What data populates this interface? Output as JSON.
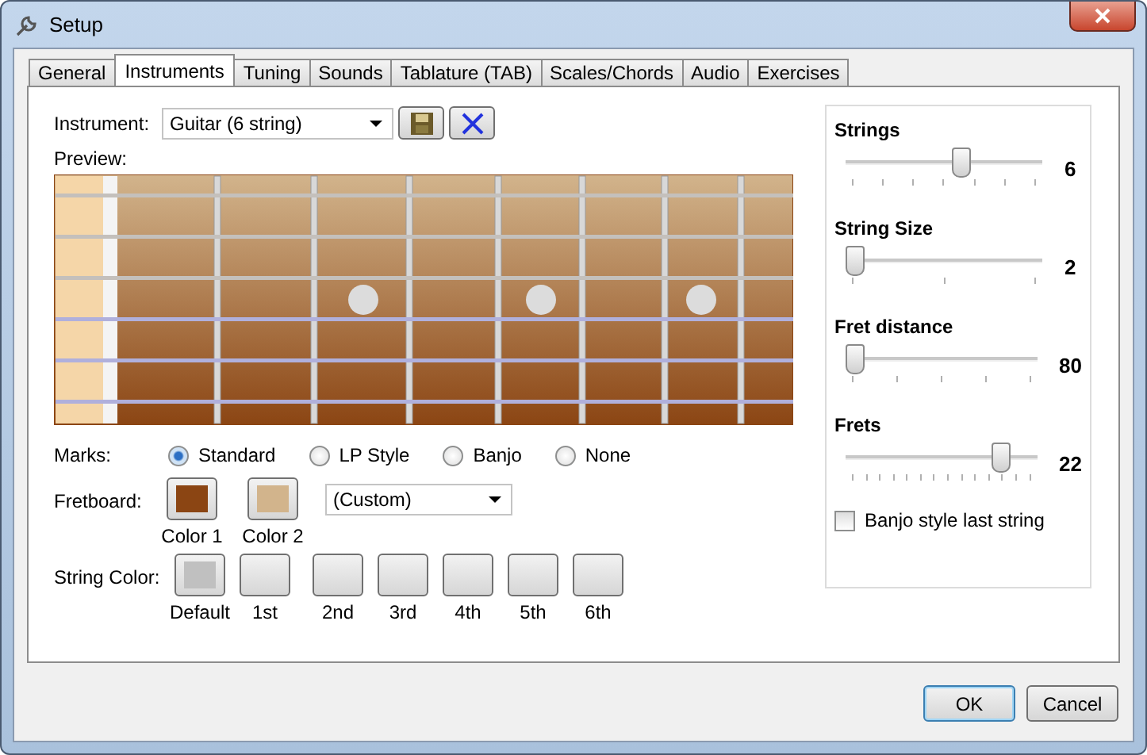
{
  "window": {
    "title": "Setup"
  },
  "tabs": [
    {
      "label": "General",
      "selected": false
    },
    {
      "label": "Instruments",
      "selected": true
    },
    {
      "label": "Tuning",
      "selected": false
    },
    {
      "label": "Sounds",
      "selected": false
    },
    {
      "label": "Tablature (TAB)",
      "selected": false
    },
    {
      "label": "Scales/Chords",
      "selected": false
    },
    {
      "label": "Audio",
      "selected": false
    },
    {
      "label": "Exercises",
      "selected": false
    }
  ],
  "instrument": {
    "label": "Instrument:",
    "value": "Guitar (6 string)"
  },
  "preview": {
    "label": "Preview:"
  },
  "marks": {
    "label": "Marks:",
    "options": [
      {
        "label": "Standard",
        "selected": true
      },
      {
        "label": "LP Style",
        "selected": false
      },
      {
        "label": "Banjo",
        "selected": false
      },
      {
        "label": "None",
        "selected": false
      }
    ]
  },
  "fretboard": {
    "label": "Fretboard:",
    "swatches": [
      {
        "label": "Color 1",
        "color": "#8b4513"
      },
      {
        "label": "Color 2",
        "color": "#d2b48c"
      }
    ],
    "preset": "(Custom)"
  },
  "string_color": {
    "label": "String Color:",
    "swatches": [
      {
        "label": "Default",
        "color": "#c0c0c0"
      },
      {
        "label": "1st"
      },
      {
        "label": "2nd"
      },
      {
        "label": "3rd"
      },
      {
        "label": "4th"
      },
      {
        "label": "5th"
      },
      {
        "label": "6th"
      }
    ]
  },
  "sliders": [
    {
      "label": "Strings",
      "level": 0.6,
      "reading": "6"
    },
    {
      "label": "String Size",
      "level": 0,
      "reading": "2"
    },
    {
      "label": "Fret distance",
      "level": 0,
      "reading": "80"
    },
    {
      "label": "Frets",
      "level": 0.82,
      "reading": "22"
    }
  ],
  "banjo": {
    "label": "Banjo style last string",
    "checked": false
  },
  "buttons": [
    "OK",
    "Cancel"
  ]
}
